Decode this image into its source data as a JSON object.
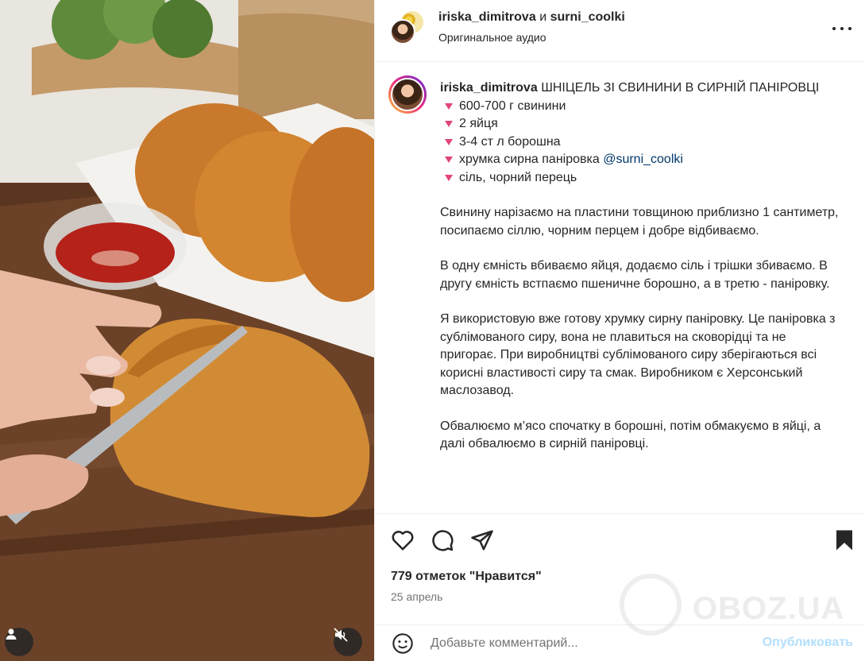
{
  "header": {
    "user1": "iriska_dimitrova",
    "and": "и",
    "user2": "surni_coolki",
    "audio": "Оригинальное аудио"
  },
  "caption": {
    "username": "iriska_dimitrova",
    "title": "ШНІЦЕЛЬ ЗІ СВИНИНИ В СИРНІЙ ПАНІРОВЦІ",
    "ingredients": [
      "600-700 г свинини",
      "2 яйця",
      "3-4 ст л борошна",
      "хрумка сирна паніровка",
      "сіль, чорний перець"
    ],
    "mention": "@surni_coolki",
    "paragraphs": [
      "Свинину нарізаємо на пластини товщиною приблизно 1 сантиметр, посипаємо сіллю, чорним перцем і добре відбиваємо.",
      "В одну ємність вбиваємо яйця, додаємо сіль і трішки збиваємо. В другу ємність встпаємо пшеничне борошно, а в третю - паніровку.",
      "Я використовую вже готову хрумку сирну паніровку. Це паніровка з сублімованого сиру, вона не плавиться на сковорідці та не пригорає. При виробництві сублімованого сиру зберігаються всі корисні властивості сиру та смак. Виробником є Херсонський маслозавод.",
      "Обвалюємо м’ясо спочатку в борошні, потім обмакуємо в яйці, а далі обвалюємо в сирній паніровці."
    ]
  },
  "actions": {
    "likes": "779 отметок \"Нравится\"",
    "date": "25 апрель"
  },
  "comment": {
    "placeholder": "Добавьте комментарий...",
    "publish": "Опубликовать"
  },
  "watermark": "OBOZ.UA",
  "colors": {
    "triangle": "#e0457b",
    "mention": "#00376b",
    "publish": "#b2dffc"
  },
  "icons": [
    "more-icon",
    "heart-icon",
    "comment-icon",
    "share-icon",
    "bookmark-icon",
    "emoji-icon",
    "user-icon",
    "mute-icon"
  ]
}
